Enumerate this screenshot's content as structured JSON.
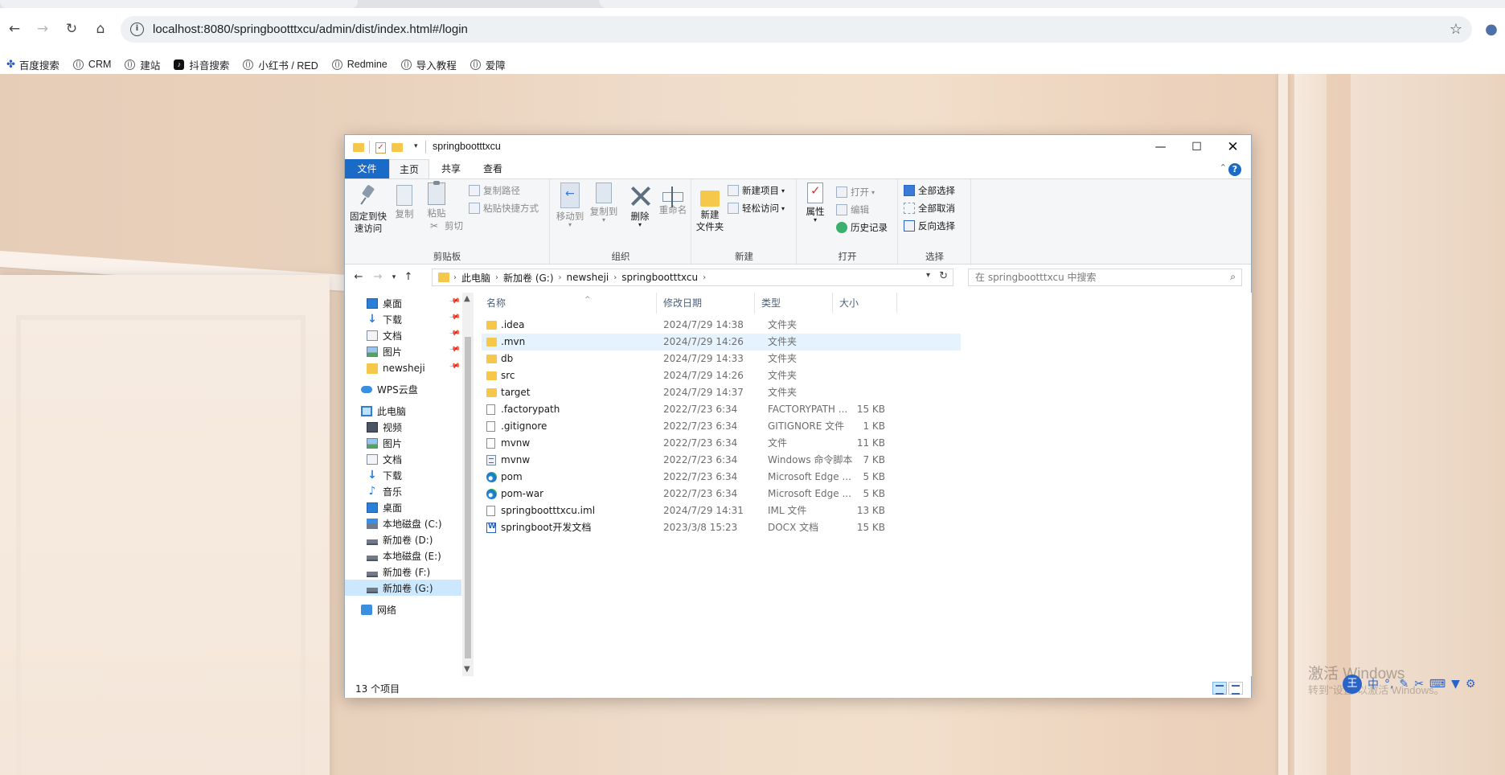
{
  "browser": {
    "url": "localhost:8080/springbootttxcu/admin/dist/index.html#/login",
    "bookmarks": [
      {
        "label": "百度搜索",
        "icon": "baidu-paw-icon"
      },
      {
        "label": "CRM",
        "icon": "globe-icon"
      },
      {
        "label": "建站",
        "icon": "globe-icon"
      },
      {
        "label": "抖音搜索",
        "icon": "tiktok-icon"
      },
      {
        "label": "小红书 / RED",
        "icon": "globe-icon"
      },
      {
        "label": "Redmine",
        "icon": "globe-icon"
      },
      {
        "label": "导入教程",
        "icon": "globe-icon"
      },
      {
        "label": "爱障",
        "icon": "globe-icon"
      }
    ]
  },
  "explorer": {
    "title": "springbootttxcu",
    "tabs": {
      "file": "文件",
      "home": "主页",
      "share": "共享",
      "view": "查看"
    },
    "ribbon": {
      "clipboard": {
        "label": "剪贴板",
        "pin_line1": "固定到快",
        "pin_line2": "速访问",
        "copy": "复制",
        "paste": "粘贴",
        "copy_path": "复制路径",
        "paste_shortcut": "粘贴快捷方式",
        "cut": "剪切"
      },
      "organize": {
        "label": "组织",
        "move_to": "移动到",
        "copy_to": "复制到",
        "delete": "删除",
        "rename": "重命名"
      },
      "new": {
        "label": "新建",
        "new_folder_line1": "新建",
        "new_folder_line2": "文件夹",
        "new_item": "新建项目",
        "easy_access": "轻松访问"
      },
      "open": {
        "label": "打开",
        "properties": "属性",
        "open": "打开",
        "edit": "编辑",
        "history": "历史记录"
      },
      "select": {
        "label": "选择",
        "select_all": "全部选择",
        "select_none": "全部取消",
        "invert": "反向选择"
      }
    },
    "breadcrumb": [
      "此电脑",
      "新加卷 (G:)",
      "newsheji",
      "springbootttxcu"
    ],
    "search_placeholder": "在 springbootttxcu 中搜索",
    "nav": [
      {
        "label": "桌面",
        "icon": "desktop-icon",
        "pinned": true
      },
      {
        "label": "下载",
        "icon": "download-icon",
        "pinned": true
      },
      {
        "label": "文档",
        "icon": "documents-icon",
        "pinned": true
      },
      {
        "label": "图片",
        "icon": "pictures-icon",
        "pinned": true
      },
      {
        "label": "newsheji",
        "icon": "folder-icon",
        "pinned": true
      },
      {
        "label": "WPS云盘",
        "icon": "cloud-icon"
      },
      {
        "label": "此电脑",
        "icon": "this-pc-icon"
      },
      {
        "label": "视频",
        "icon": "videos-icon"
      },
      {
        "label": "图片",
        "icon": "pictures-icon"
      },
      {
        "label": "文档",
        "icon": "documents-icon"
      },
      {
        "label": "下载",
        "icon": "download-icon"
      },
      {
        "label": "音乐",
        "icon": "music-icon"
      },
      {
        "label": "桌面",
        "icon": "desktop-icon"
      },
      {
        "label": "本地磁盘 (C:)",
        "icon": "system-drive-icon"
      },
      {
        "label": "新加卷 (D:)",
        "icon": "drive-icon"
      },
      {
        "label": "本地磁盘 (E:)",
        "icon": "drive-icon"
      },
      {
        "label": "新加卷 (F:)",
        "icon": "drive-icon"
      },
      {
        "label": "新加卷 (G:)",
        "icon": "drive-icon",
        "selected": true
      },
      {
        "label": "网络",
        "icon": "network-icon"
      }
    ],
    "columns": {
      "name": "名称",
      "date": "修改日期",
      "type": "类型",
      "size": "大小"
    },
    "files": [
      {
        "name": ".idea",
        "date": "2024/7/29 14:38",
        "type": "文件夹",
        "size": "",
        "icon": "folder-icon"
      },
      {
        "name": ".mvn",
        "date": "2024/7/29 14:26",
        "type": "文件夹",
        "size": "",
        "icon": "folder-icon"
      },
      {
        "name": "db",
        "date": "2024/7/29 14:33",
        "type": "文件夹",
        "size": "",
        "icon": "folder-icon"
      },
      {
        "name": "src",
        "date": "2024/7/29 14:26",
        "type": "文件夹",
        "size": "",
        "icon": "folder-icon"
      },
      {
        "name": "target",
        "date": "2024/7/29 14:37",
        "type": "文件夹",
        "size": "",
        "icon": "folder-icon"
      },
      {
        "name": ".factorypath",
        "date": "2022/7/23 6:34",
        "type": "FACTORYPATH ...",
        "size": "15 KB",
        "icon": "file-icon"
      },
      {
        "name": ".gitignore",
        "date": "2022/7/23 6:34",
        "type": "GITIGNORE 文件",
        "size": "1 KB",
        "icon": "file-icon"
      },
      {
        "name": "mvnw",
        "date": "2022/7/23 6:34",
        "type": "文件",
        "size": "11 KB",
        "icon": "file-icon"
      },
      {
        "name": "mvnw",
        "date": "2022/7/23 6:34",
        "type": "Windows 命令脚本",
        "size": "7 KB",
        "icon": "cmd-script-icon"
      },
      {
        "name": "pom",
        "date": "2022/7/23 6:34",
        "type": "Microsoft Edge ...",
        "size": "5 KB",
        "icon": "edge-icon"
      },
      {
        "name": "pom-war",
        "date": "2022/7/23 6:34",
        "type": "Microsoft Edge ...",
        "size": "5 KB",
        "icon": "edge-icon"
      },
      {
        "name": "springbootttxcu.iml",
        "date": "2024/7/29 14:31",
        "type": "IML 文件",
        "size": "13 KB",
        "icon": "file-icon"
      },
      {
        "name": "springboot开发文档",
        "date": "2023/3/8 15:23",
        "type": "DOCX 文档",
        "size": "15 KB",
        "icon": "word-doc-icon"
      }
    ],
    "status": "13 个项目"
  },
  "desktop": {
    "watermark_line1": "激活 Windows",
    "watermark_line2": "转到\"设置\"以激活 Windows。",
    "ime_label": "中"
  }
}
